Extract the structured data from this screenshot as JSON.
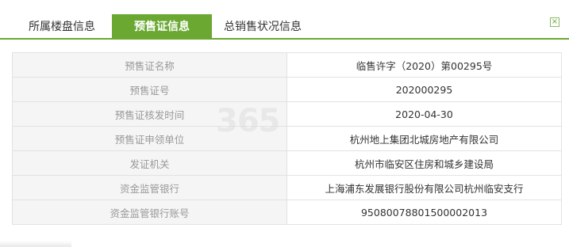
{
  "tabs": [
    {
      "label": "所属楼盘信息"
    },
    {
      "label": "预售证信息"
    },
    {
      "label": "总销售状况信息"
    }
  ],
  "close_icon": "close-icon",
  "table": {
    "rows": [
      {
        "label": "预售证名称",
        "value": "临售许字（2020）第00295号"
      },
      {
        "label": "预售证号",
        "value": "202000295"
      },
      {
        "label": "预售证核发时间",
        "value": "2020-04-30"
      },
      {
        "label": "预售证申领单位",
        "value": "杭州地上集团北城房地产有限公司"
      },
      {
        "label": "发证机关",
        "value": "杭州市临安区住房和城乡建设局"
      },
      {
        "label": "资金监管银行",
        "value": "上海浦东发展银行股份有限公司杭州临安支行"
      },
      {
        "label": "资金监管银行账号",
        "value": "95080078801500002013"
      }
    ]
  },
  "watermark": "365"
}
